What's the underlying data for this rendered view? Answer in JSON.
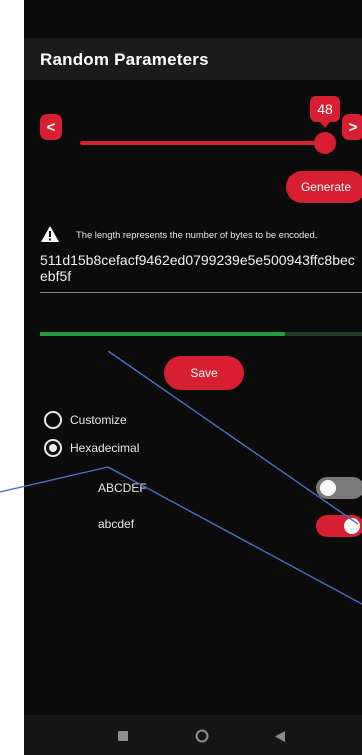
{
  "app": {
    "title": "Random Parameters"
  },
  "slider": {
    "value": "48",
    "decrement_label": "<",
    "increment_label": ">",
    "fill_fraction": 0.98
  },
  "actions": {
    "generate_label": "Generate",
    "save_label": "Save"
  },
  "notice": {
    "text": "The length represents the number of bytes to be encoded.",
    "icon": "warning-icon"
  },
  "output": {
    "value": "511d15b8cefacf9462ed0799239e5e500943ffc8becebf5f"
  },
  "progress": {
    "fraction": 0.76
  },
  "format": {
    "options": [
      {
        "label": "Customize",
        "selected": false
      },
      {
        "label": "Hexadecimal",
        "selected": true
      }
    ]
  },
  "charset": {
    "toggles": [
      {
        "label": "ABCDEF",
        "on": false
      },
      {
        "label": "abcdef",
        "on": true
      }
    ]
  },
  "navbar": {
    "icons": [
      "recents-icon",
      "home-icon",
      "back-icon"
    ]
  },
  "colors": {
    "accent": "#d81f31",
    "background": "#0b0b0b",
    "progress": "#1f9a3c",
    "annotation_line": "#4a6fc7"
  }
}
